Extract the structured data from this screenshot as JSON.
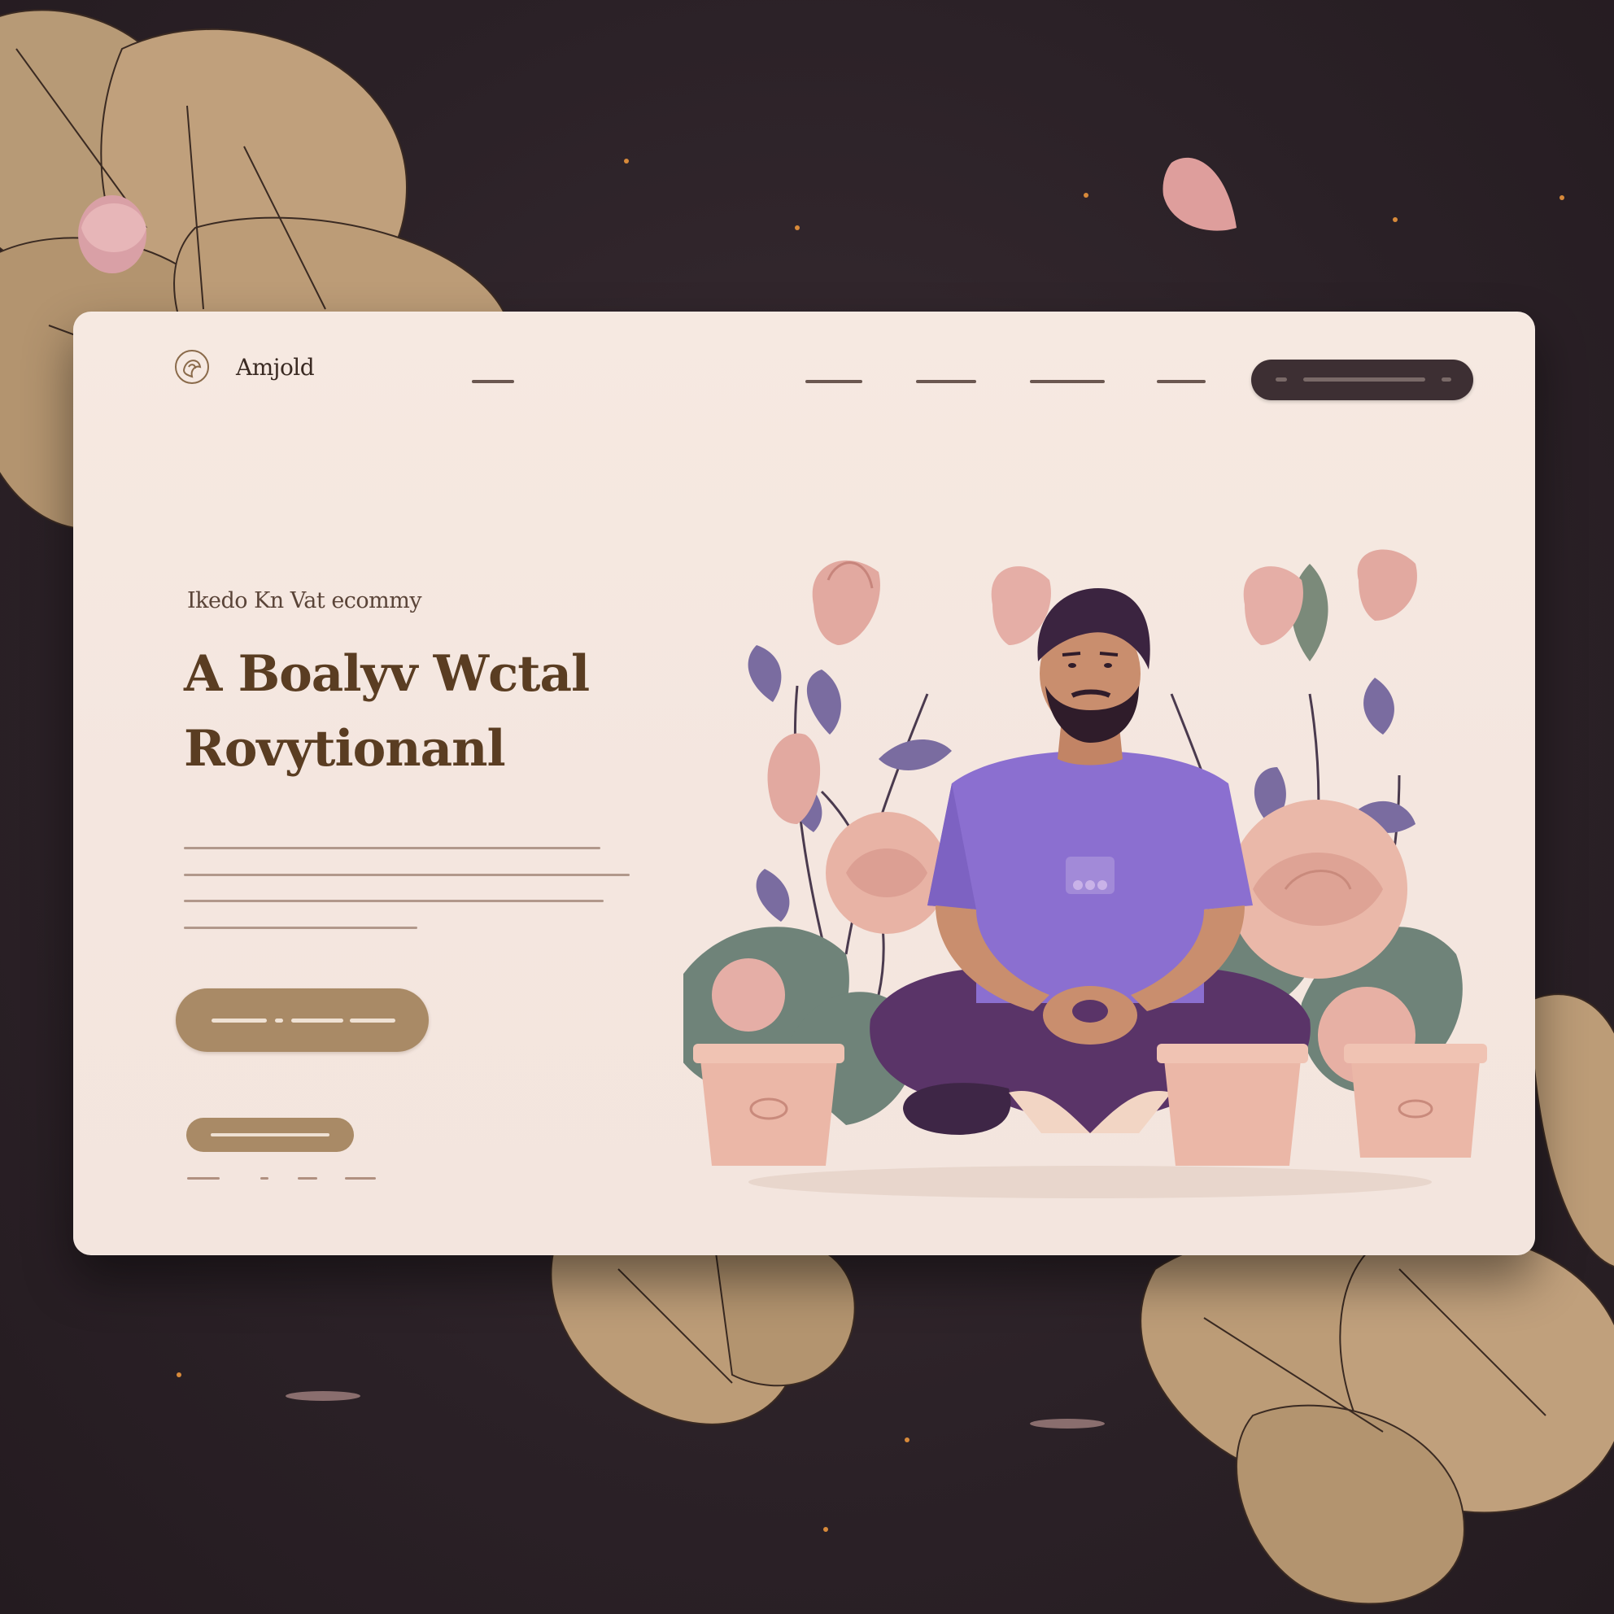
{
  "brand": {
    "name": "Amjold"
  },
  "hero": {
    "eyebrow": "Ikedo Kn Vat ecommy",
    "headline": "A Boalyv Wctal\nRovytionanl"
  },
  "colors": {
    "background": "#2b2127",
    "card": "#f5e8e0",
    "accent_gold": "#a98a66",
    "dark_button": "#3d2f33",
    "shirt_purple": "#8b6fd0",
    "pants_purple": "#5a3468",
    "petal_pink": "#e2a9a0"
  },
  "icons": [
    "logo-rose-icon",
    "flower-leaf-decoration",
    "meditating-man-illustration"
  ]
}
